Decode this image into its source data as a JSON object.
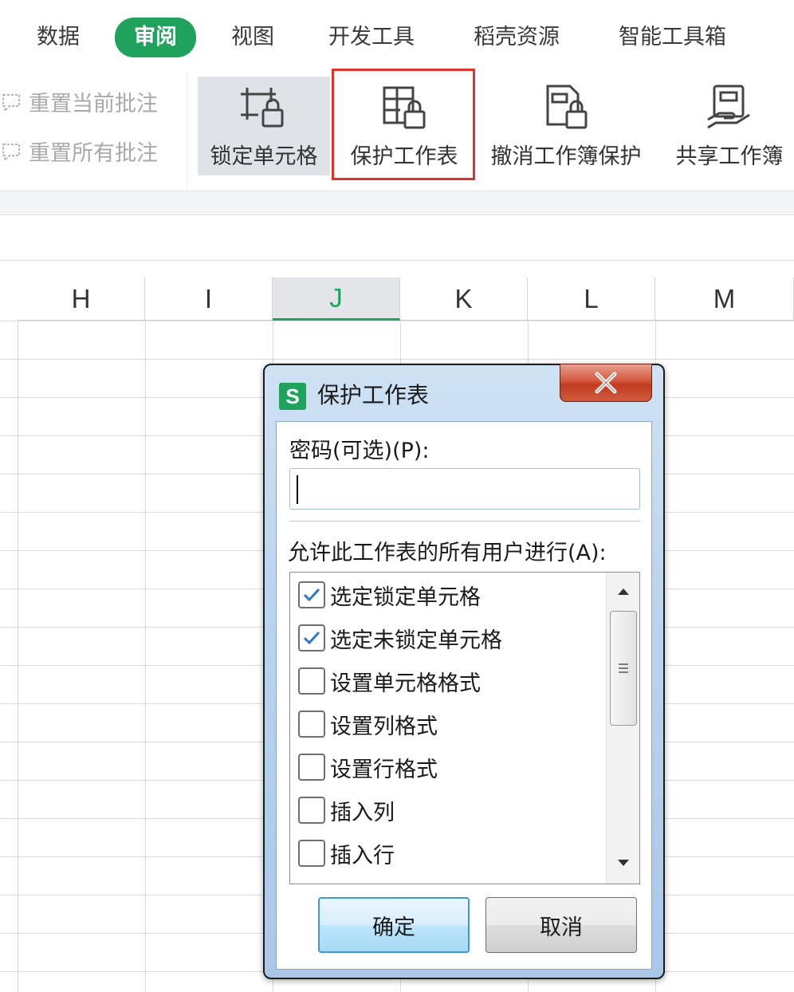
{
  "menu": {
    "items": [
      "数据",
      "审阅",
      "视图",
      "开发工具",
      "稻壳资源",
      "智能工具箱"
    ],
    "active": "审阅"
  },
  "ribbon": {
    "reset_current_comment": "重置当前批注",
    "reset_all_comments": "重置所有批注",
    "lock_cells": "锁定单元格",
    "protect_sheet": "保护工作表",
    "unprotect_workbook": "撤消工作簿保护",
    "share_workbook": "共享工作簿"
  },
  "grid": {
    "columns": [
      "H",
      "I",
      "J",
      "K",
      "L",
      "M"
    ],
    "selected_column": "J"
  },
  "dialog": {
    "app_icon_letter": "S",
    "title": "保护工作表",
    "password_label": "密码(可选)(P):",
    "password_value": "",
    "allow_label": "允许此工作表的所有用户进行(A):",
    "permissions": [
      {
        "label": "选定锁定单元格",
        "checked": true
      },
      {
        "label": "选定未锁定单元格",
        "checked": true
      },
      {
        "label": "设置单元格格式",
        "checked": false
      },
      {
        "label": "设置列格式",
        "checked": false
      },
      {
        "label": "设置行格式",
        "checked": false
      },
      {
        "label": "插入列",
        "checked": false
      },
      {
        "label": "插入行",
        "checked": false
      }
    ],
    "ok_label": "确定",
    "cancel_label": "取消"
  },
  "colors": {
    "accent_green": "#1fa35c",
    "highlight_red": "#e2332b",
    "dialog_blue": "#b9d4ee",
    "checkmark_blue": "#2b79c9"
  }
}
